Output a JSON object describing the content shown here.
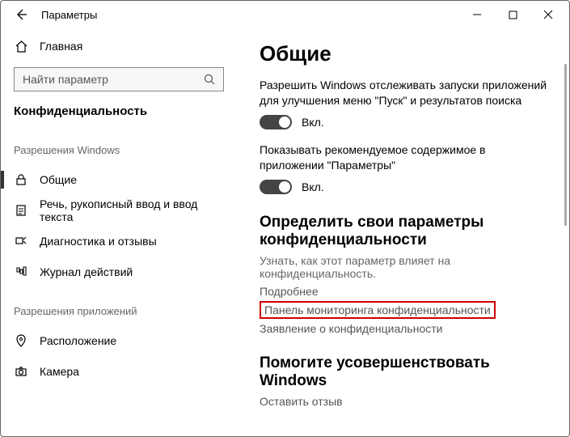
{
  "window": {
    "title": "Параметры"
  },
  "sidebar": {
    "home_label": "Главная",
    "search_placeholder": "Найти параметр",
    "section_label": "Конфиденциальность",
    "group1_label": "Разрешения Windows",
    "group2_label": "Разрешения приложений",
    "items": {
      "general": "Общие",
      "speech": "Речь, рукописный ввод и ввод текста",
      "diagnostics": "Диагностика и отзывы",
      "activity": "Журнал действий",
      "location": "Расположение",
      "camera": "Камера"
    }
  },
  "content": {
    "heading": "Общие",
    "setting1_desc": "Разрешить Windows отслеживать запуски приложений для улучшения меню \"Пуск\" и результатов поиска",
    "setting2_desc": "Показывать рекомендуемое содержимое в приложении \"Параметры\"",
    "toggle_on": "Вкл.",
    "section2_heading": "Определить свои параметры конфиденциальности",
    "section2_desc": "Узнать, как этот параметр влияет на конфиденциальность.",
    "link_more": "Подробнее",
    "link_dashboard": "Панель мониторинга конфиденциальности",
    "link_statement": "Заявление о конфиденциальности",
    "section3_heading": "Помогите усовершенствовать Windows",
    "link_feedback": "Оставить отзыв"
  }
}
